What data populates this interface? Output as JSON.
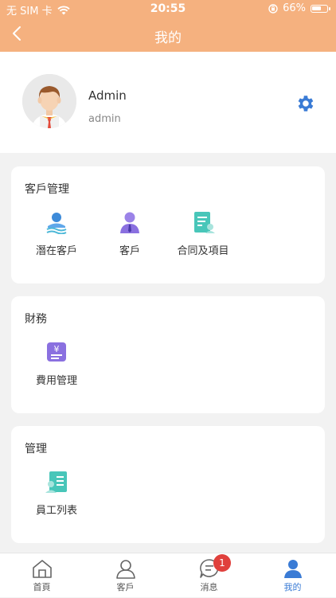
{
  "status": {
    "carrier": "无 SIM 卡",
    "time": "20:55",
    "battery": "66%",
    "battery_level": 0.66
  },
  "nav": {
    "title": "我的"
  },
  "profile": {
    "name": "Admin",
    "username": "admin"
  },
  "sections": [
    {
      "title": "客戶管理",
      "items": [
        {
          "label": "潛在客戶",
          "icon": "prospect-icon"
        },
        {
          "label": "客戶",
          "icon": "customer-icon"
        },
        {
          "label": "合同及項目",
          "icon": "contract-icon"
        }
      ]
    },
    {
      "title": "財務",
      "items": [
        {
          "label": "費用管理",
          "icon": "expense-icon"
        }
      ]
    },
    {
      "title": "管理",
      "items": [
        {
          "label": "員工列表",
          "icon": "employee-list-icon"
        }
      ]
    }
  ],
  "tabbar": {
    "tabs": [
      {
        "label": "首頁",
        "icon": "home-icon"
      },
      {
        "label": "客戶",
        "icon": "user-outline-icon"
      },
      {
        "label": "消息",
        "icon": "message-icon",
        "badge": "1"
      },
      {
        "label": "我的",
        "icon": "person-icon",
        "active": true
      }
    ]
  },
  "colors": {
    "header": "#f5b17f",
    "accent": "#3a7bd5",
    "badge": "#e0403c"
  }
}
